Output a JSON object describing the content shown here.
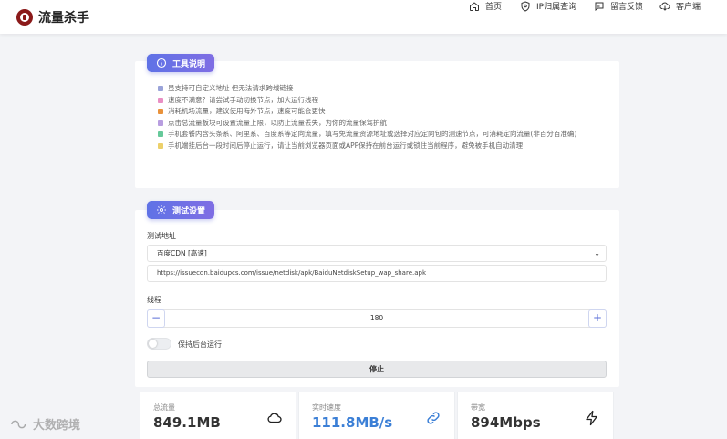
{
  "app": {
    "title": "流量杀手"
  },
  "nav": [
    {
      "label": "首页",
      "icon": "home-icon"
    },
    {
      "label": "IP归属查询",
      "icon": "shield-icon"
    },
    {
      "label": "留言反馈",
      "icon": "chat-icon"
    },
    {
      "label": "客户端",
      "icon": "cloud-download-icon"
    }
  ],
  "info": {
    "title": "工具说明",
    "tips": [
      {
        "text": "虽支持可自定义地址 但无法请求跨域链接",
        "color": "#9aa3d9"
      },
      {
        "text": "速度不满意？请尝试手动切换节点，加大运行线程",
        "color": "#e98fc4"
      },
      {
        "text": "消耗机场流量，建议使用海外节点，速度可能会更快",
        "color": "#e9923b"
      },
      {
        "text": "点击总流量板块可设置流量上限，以防止流量丢失，为你的流量保驾护航",
        "color": "#b89ee0"
      },
      {
        "text": "手机套餐内含头条系、阿里系、百度系等定向流量，填写免流量资源地址或选择对应定向包的测速节点，可消耗定向流量(非百分百准确)",
        "color": "#66c99a"
      },
      {
        "text": "手机端挂后台一段时间后停止运行，请让当前浏览器页面或APP保持在前台运行或锁住当前程序，避免被手机自动清理",
        "color": "#ecd06a"
      }
    ]
  },
  "test": {
    "title": "测试设置",
    "address_label": "测试地址",
    "address_selected": "百度CDN [高速]",
    "url_value": "https://issuecdn.baidupcs.com/issue/netdisk/apk/BaiduNetdiskSetup_wap_share.apk",
    "threads_label": "线程",
    "threads_value": "180",
    "minus": "−",
    "plus": "+",
    "keep_running_label": "保持后台运行",
    "stop_label": "停止"
  },
  "stats": [
    {
      "title": "总流量",
      "value": "849.1MB",
      "icon": "cloud-icon"
    },
    {
      "title": "实时速度",
      "value": "111.8MB/s",
      "icon": "link-icon"
    },
    {
      "title": "带宽",
      "value": "894Mbps",
      "icon": "lightning-icon"
    }
  ],
  "watermark": {
    "text": "大数跨境"
  }
}
